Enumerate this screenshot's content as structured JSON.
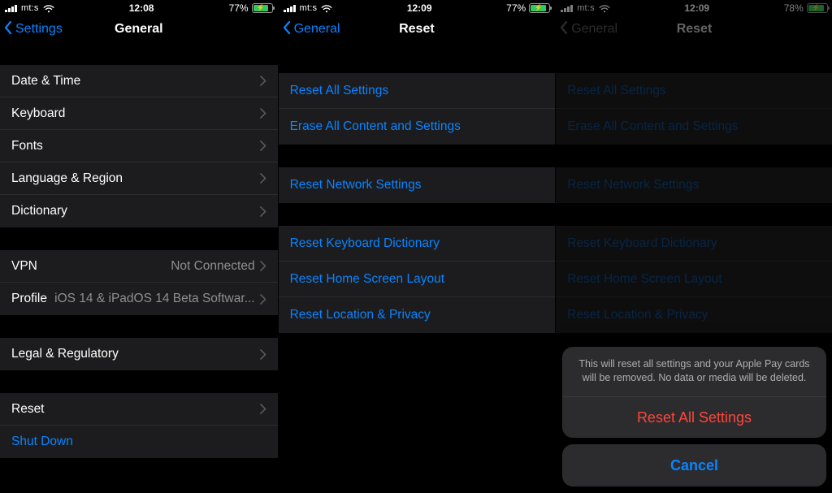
{
  "screens": [
    {
      "status": {
        "carrier": "mt:s",
        "time": "12:08",
        "battery_pct": "77%",
        "battery_fill": 77
      },
      "nav": {
        "back": "Settings",
        "title": "General"
      },
      "groups": [
        {
          "rows": [
            {
              "label": "Date & Time",
              "chevron": true
            },
            {
              "label": "Keyboard",
              "chevron": true
            },
            {
              "label": "Fonts",
              "chevron": true
            },
            {
              "label": "Language & Region",
              "chevron": true
            },
            {
              "label": "Dictionary",
              "chevron": true
            }
          ]
        },
        {
          "rows": [
            {
              "label": "VPN",
              "value": "Not Connected",
              "chevron": true
            },
            {
              "label": "Profile",
              "value": "iOS 14 & iPadOS 14 Beta Softwar...",
              "chevron": true
            }
          ]
        },
        {
          "rows": [
            {
              "label": "Legal & Regulatory",
              "chevron": true
            }
          ]
        },
        {
          "rows": [
            {
              "label": "Reset",
              "chevron": true
            },
            {
              "label": "Shut Down",
              "link": true
            }
          ]
        }
      ]
    },
    {
      "status": {
        "carrier": "mt:s",
        "time": "12:09",
        "battery_pct": "77%",
        "battery_fill": 77
      },
      "nav": {
        "back": "General",
        "title": "Reset"
      },
      "groups": [
        {
          "rows": [
            {
              "label": "Reset All Settings",
              "action": true
            },
            {
              "label": "Erase All Content and Settings",
              "action": true
            }
          ]
        },
        {
          "rows": [
            {
              "label": "Reset Network Settings",
              "action": true
            }
          ]
        },
        {
          "rows": [
            {
              "label": "Reset Keyboard Dictionary",
              "action": true
            },
            {
              "label": "Reset Home Screen Layout",
              "action": true
            },
            {
              "label": "Reset Location & Privacy",
              "action": true
            }
          ]
        }
      ]
    },
    {
      "status": {
        "carrier": "mt:s",
        "time": "12:09",
        "battery_pct": "78%",
        "battery_fill": 78
      },
      "nav": {
        "back": "General",
        "title": "Reset",
        "dim": true
      },
      "groups": [
        {
          "rows": [
            {
              "label": "Reset All Settings",
              "subtle": true
            },
            {
              "label": "Erase All Content and Settings",
              "subtle": true
            }
          ]
        },
        {
          "rows": [
            {
              "label": "Reset Network Settings",
              "subtle": true
            }
          ]
        },
        {
          "rows": [
            {
              "label": "Reset Keyboard Dictionary",
              "subtle": true
            },
            {
              "label": "Reset Home Screen Layout",
              "subtle": true
            },
            {
              "label": "Reset Location & Privacy",
              "subtle": true
            }
          ]
        }
      ],
      "sheet": {
        "message": "This will reset all settings and your Apple Pay cards will be removed. No data or media will be deleted.",
        "destructive": "Reset All Settings",
        "cancel": "Cancel"
      }
    }
  ]
}
